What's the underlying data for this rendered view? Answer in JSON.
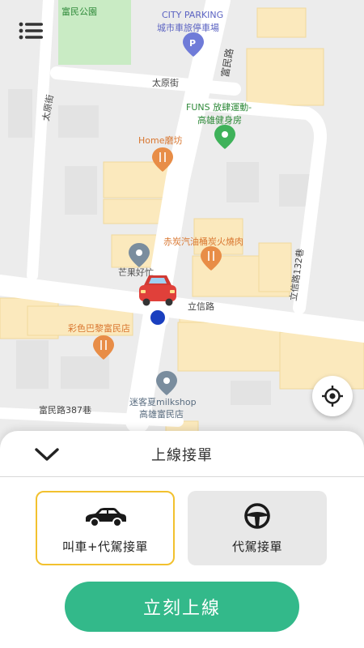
{
  "map": {
    "labels": {
      "park": "富民公園",
      "parking_1": "CITY PARKING",
      "parking_2": "城市車旅停車場",
      "road_fumin": "富民路",
      "road_taiyuan_top": "太原街",
      "road_taiyuan_side": "太原街",
      "gym_1": "FUNS 放肆運動-",
      "gym_2": "高雄健身房",
      "home_restaurant": "Home磨坊",
      "bbq": "赤炭汽油桶炭火燒肉",
      "lane_132": "立信路132巷",
      "mango": "芒果好忙",
      "lixin_road": "立信路",
      "caise": "彩色巴黎富民店",
      "milkshop_1": "迷客夏milkshop",
      "milkshop_2": "高雄富民店",
      "lane_387": "富民路387巷"
    },
    "colors": {
      "road": "#ffffff",
      "block": "#ececec",
      "building_yellow": "#fbe9bd",
      "park": "#c9ebc4",
      "poi_orange": "#e88d47",
      "poi_grey": "#7a8d9e",
      "poi_green": "#3fb25a",
      "parking_purple": "#6f7bd8",
      "location_dot": "#1a3fbf"
    }
  },
  "icons": {
    "menu": "menu-icon",
    "locate": "my-location-icon",
    "collapse": "chevron-down-icon",
    "car": "car-icon",
    "steering": "steering-wheel-icon"
  },
  "sheet": {
    "title": "上線接單",
    "options": [
      {
        "label": "叫車+代駕接單",
        "selected": true
      },
      {
        "label": "代駕接單",
        "selected": false
      }
    ],
    "go_online_label": "立刻上線"
  },
  "theme": {
    "accent_green": "#33b98a",
    "selected_border": "#f2c12e",
    "unselected_bg": "#e8e8e8"
  }
}
